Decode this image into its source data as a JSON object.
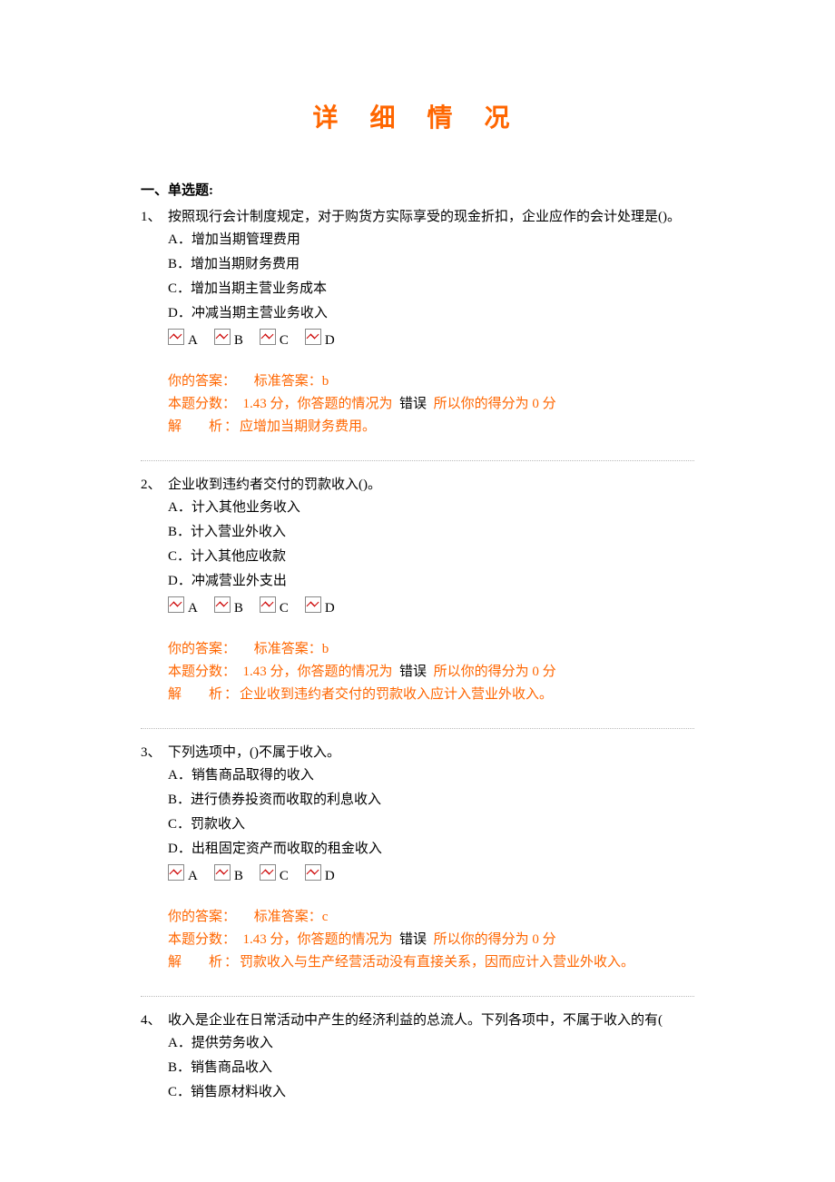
{
  "title": "详 细 情 况",
  "section_heading": "一、单选题:",
  "option_letters": [
    "A",
    "B",
    "C",
    "D"
  ],
  "labels": {
    "your_answer": "你的答案：",
    "std_answer": "标准答案：",
    "score_prefix": "本题分数：",
    "fen": "分",
    "result_sentence": "，你答题的情况为",
    "so_score": "所以你的得分为",
    "analysis_label_1": "解",
    "analysis_label_2": "析：",
    "result_wrong": "错误"
  },
  "questions": [
    {
      "num": "1、",
      "stem": "按照现行会计制度规定，对于购货方实际享受的现金折扣，企业应作的会计处理是()。",
      "opts": [
        "A．增加当期管理费用",
        "B．增加当期财务费用",
        "C．增加当期主营业务成本",
        "D．冲减当期主营业务收入"
      ],
      "std_answer": "b",
      "points": "1.43",
      "earned": "0",
      "analysis": "应增加当期财务费用。"
    },
    {
      "num": "2、",
      "stem": "企业收到违约者交付的罚款收入()。",
      "opts": [
        "A．计入其他业务收入",
        "B．计入营业外收入",
        "C．计入其他应收款",
        "D．冲减营业外支出"
      ],
      "std_answer": "b",
      "points": "1.43",
      "earned": "0",
      "analysis": "企业收到违约者交付的罚款收入应计入营业外收入。"
    },
    {
      "num": "3、",
      "stem": "下列选项中，()不属于收入。",
      "opts": [
        "A．销售商品取得的收入",
        "B．进行债券投资而收取的利息收入",
        "C．罚款收入",
        "D．出租固定资产而收取的租金收入"
      ],
      "std_answer": "c",
      "points": "1.43",
      "earned": "0",
      "analysis": "罚款收入与生产经营活动没有直接关系，因而应计入营业外收入。"
    },
    {
      "num": "4、",
      "stem": "收入是企业在日常活动中产生的经济利益的总流人。下列各项中，不属于收入的有(",
      "opts": [
        "A．提供劳务收入",
        "B．销售商品收入",
        "C．销售原材料收入"
      ]
    }
  ]
}
